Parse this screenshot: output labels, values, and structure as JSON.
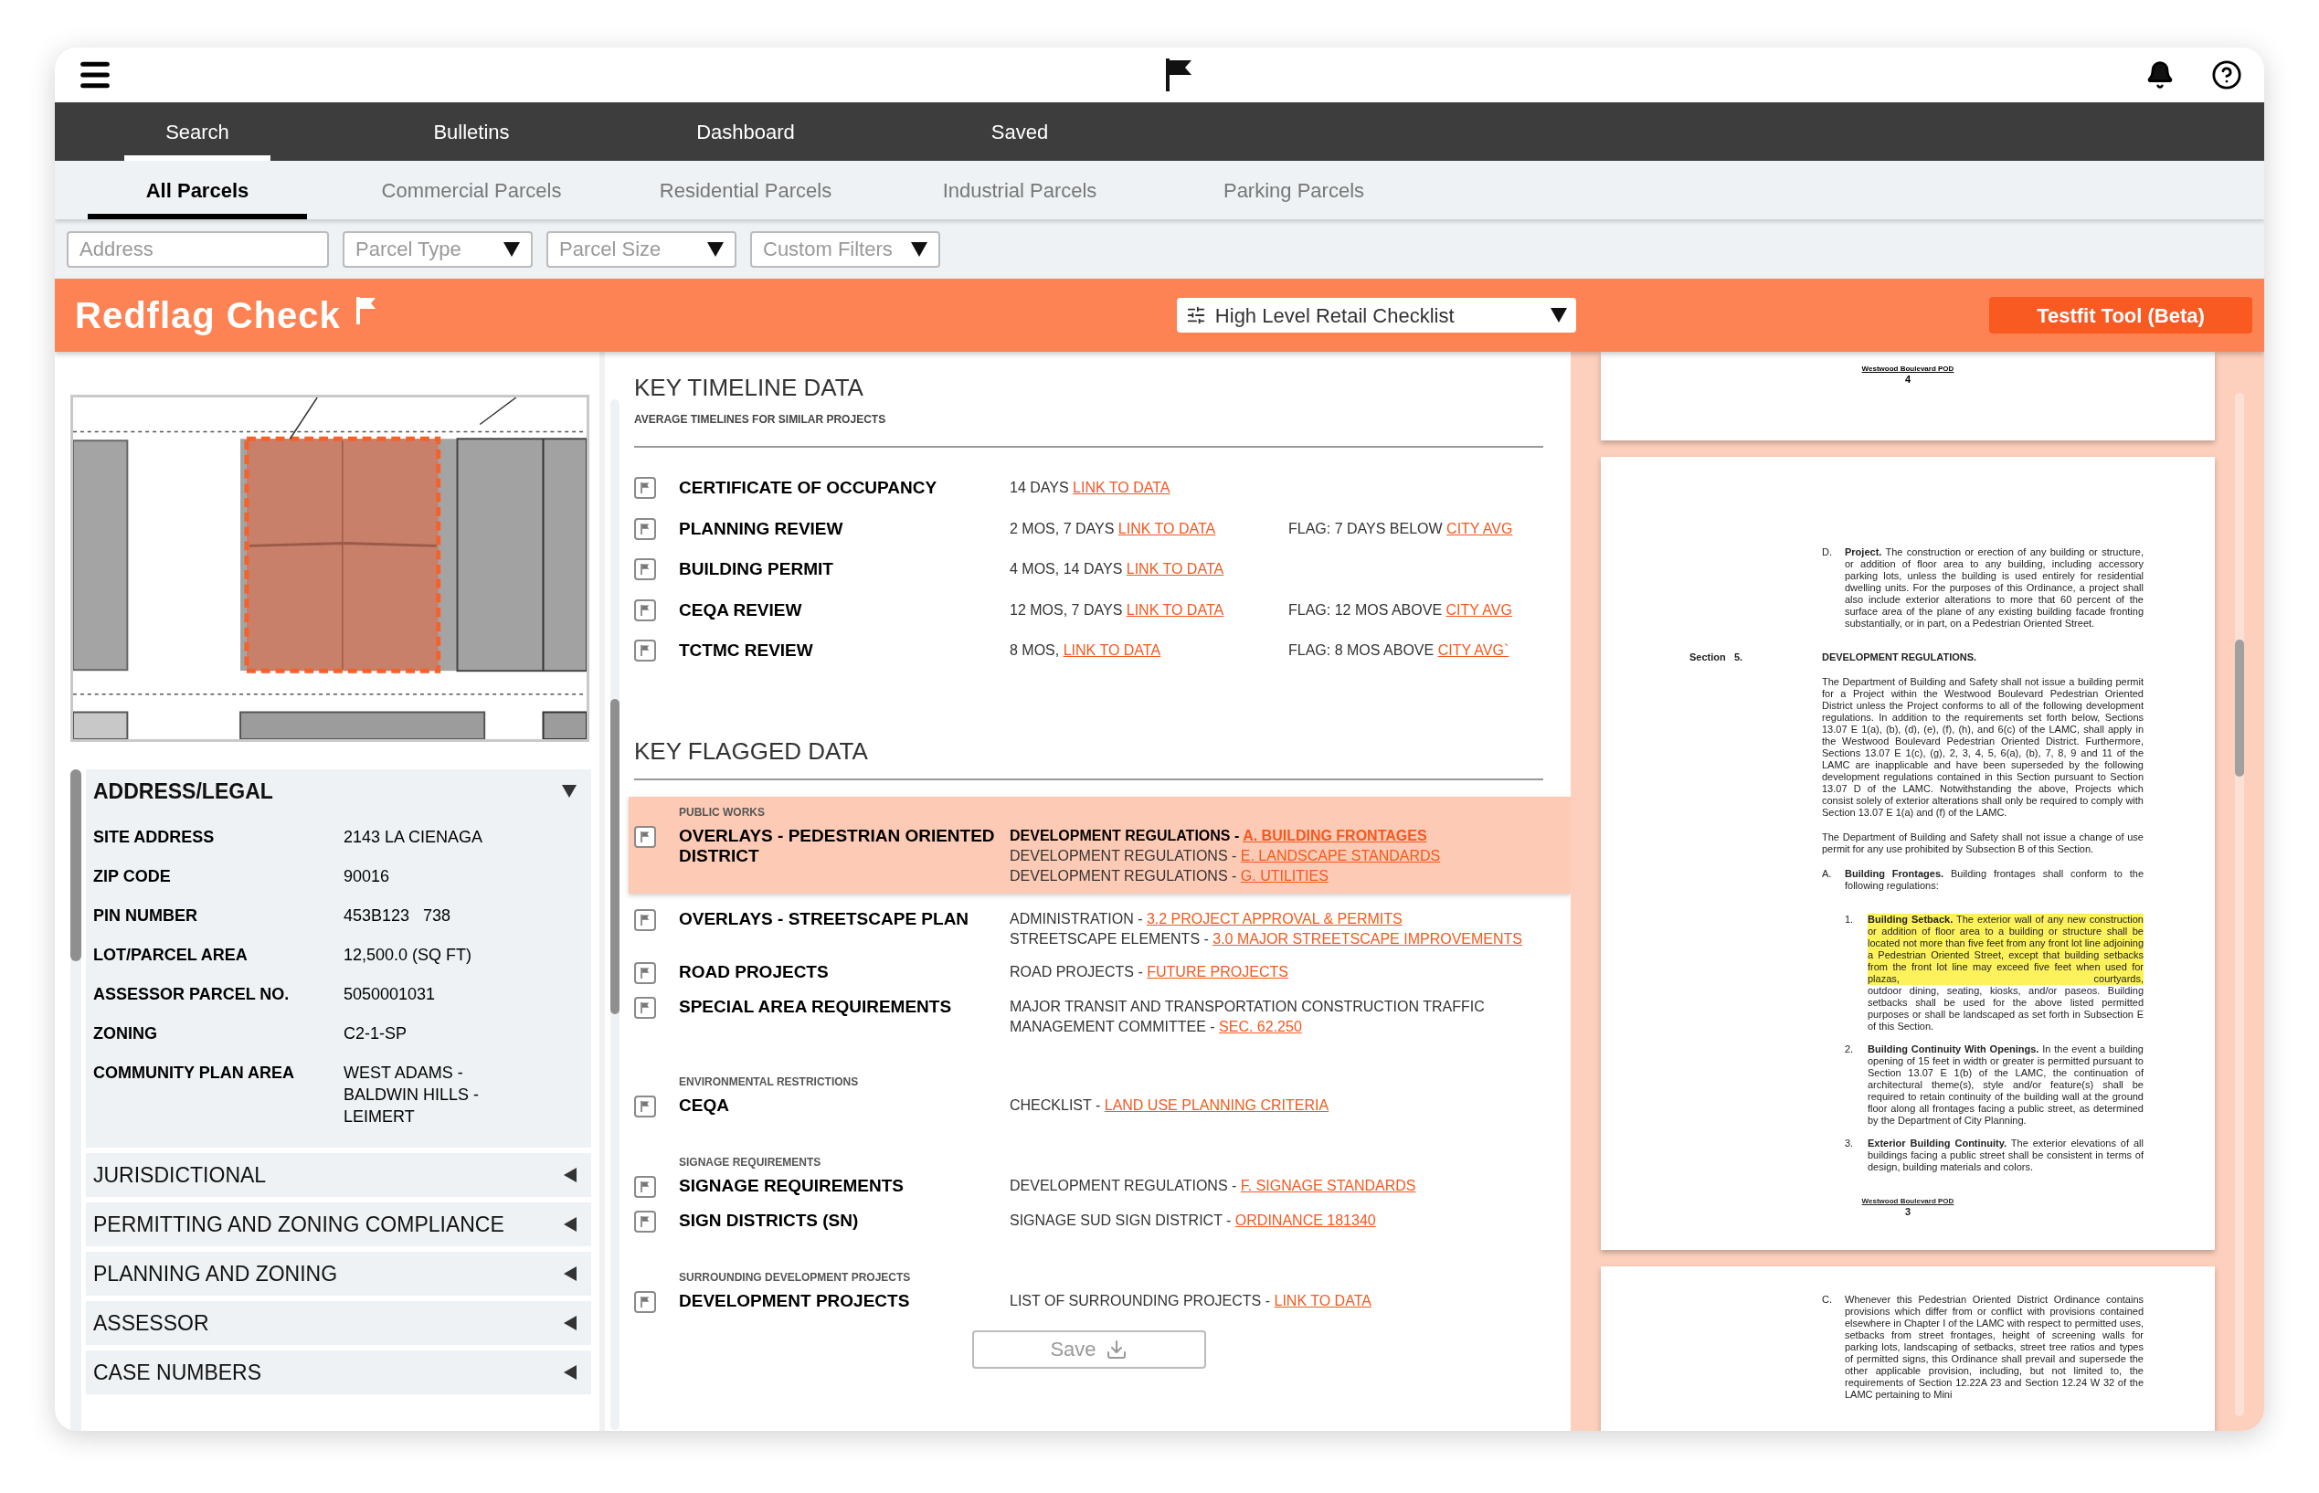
{
  "nav_tabs": [
    {
      "label": "Search",
      "selected": true
    },
    {
      "label": "Bulletins",
      "selected": false
    },
    {
      "label": "Dashboard",
      "selected": false
    },
    {
      "label": "Saved",
      "selected": false
    }
  ],
  "sub_tabs": [
    {
      "label": "All Parcels",
      "selected": true
    },
    {
      "label": "Commercial Parcels",
      "selected": false
    },
    {
      "label": "Residential Parcels",
      "selected": false
    },
    {
      "label": "Industrial Parcels",
      "selected": false
    },
    {
      "label": "Parking Parcels",
      "selected": false
    }
  ],
  "filters": [
    {
      "kind": "text",
      "placeholder": "Address"
    },
    {
      "kind": "select",
      "label": "Parcel Type"
    },
    {
      "kind": "select",
      "label": "Parcel Size"
    },
    {
      "kind": "select",
      "label": "Custom Filters"
    }
  ],
  "banner": {
    "title": "Redflag Check",
    "checklist": "High Level Retail Checklist",
    "button": "Testfit Tool (Beta)"
  },
  "accordion": [
    {
      "title": "ADDRESS/LEGAL",
      "expanded": true,
      "fields": [
        {
          "label": "SITE ADDRESS",
          "value": "2143 LA CIENAGA"
        },
        {
          "label": "ZIP CODE",
          "value": "90016"
        },
        {
          "label": "PIN NUMBER",
          "value": "453B123   738"
        },
        {
          "label": "LOT/PARCEL AREA",
          "value": "12,500.0 (SQ FT)"
        },
        {
          "label": "ASSESSOR PARCEL NO.",
          "value": "5050001031"
        },
        {
          "label": "ZONING",
          "value": "C2-1-SP"
        },
        {
          "label": "COMMUNITY PLAN AREA",
          "value": "WEST ADAMS - BALDWIN HILLS - LEIMERT"
        }
      ]
    },
    {
      "title": "JURISDICTIONAL",
      "expanded": false
    },
    {
      "title": "PERMITTING AND ZONING COMPLIANCE",
      "expanded": false
    },
    {
      "title": "PLANNING AND ZONING",
      "expanded": false
    },
    {
      "title": "ASSESSOR",
      "expanded": false
    },
    {
      "title": "CASE NUMBERS",
      "expanded": false
    }
  ],
  "timeline": {
    "title": "KEY TIMELINE DATA",
    "subtitle": "AVERAGE TIMELINES FOR SIMILAR PROJECTS",
    "rows": [
      {
        "label": "CERTIFICATE OF OCCUPANCY",
        "value": "14 DAYS",
        "link": "LINK TO DATA"
      },
      {
        "label": "PLANNING REVIEW",
        "value": "2 MOS, 7 DAYS",
        "link": "LINK TO DATA",
        "flag": "FLAG: 7 DAYS BELOW",
        "flag_link": "CITY AVG"
      },
      {
        "label": "BUILDING PERMIT",
        "value": "4 MOS, 14 DAYS",
        "link": "LINK TO DATA"
      },
      {
        "label": "CEQA REVIEW",
        "value": "12 MOS, 7 DAYS",
        "link": "LINK TO DATA",
        "flag": "FLAG: 12 MOS ABOVE",
        "flag_link": "CITY AVG"
      },
      {
        "label": "TCTMC REVIEW",
        "value": "8 MOS,",
        "link": "LINK TO DATA",
        "flag": "FLAG: 8 MOS ABOVE",
        "flag_link": "CITY AVG`"
      }
    ]
  },
  "flagged": {
    "title": "KEY FLAGGED DATA",
    "save": "Save",
    "rows": [
      {
        "category": "PUBLIC WORKS",
        "label": "OVERLAYS - PEDESTRIAN ORIENTED DISTRICT",
        "selected": true,
        "details": [
          {
            "text": "DEVELOPMENT REGULATIONS - ",
            "link": "A. BUILDING FRONTAGES",
            "bold": true
          },
          {
            "text": "DEVELOPMENT REGULATIONS - ",
            "link": "E. LANDSCAPE STANDARDS",
            "bold": false
          },
          {
            "text": "DEVELOPMENT REGULATIONS - ",
            "link": "G. UTILITIES",
            "bold": false
          }
        ]
      },
      {
        "label": "OVERLAYS - STREETSCAPE PLAN",
        "selected": false,
        "details": [
          {
            "text": "ADMINISTRATION - ",
            "link": "3.2 PROJECT APPROVAL & PERMITS",
            "bold": false
          },
          {
            "text": "STREETSCAPE ELEMENTS - ",
            "link": "3.0 MAJOR STREETSCAPE IMPROVEMENTS",
            "bold": false
          }
        ]
      },
      {
        "label": "ROAD PROJECTS",
        "selected": false,
        "details": [
          {
            "text": "ROAD PROJECTS - ",
            "link": "FUTURE PROJECTS",
            "bold": false
          }
        ]
      },
      {
        "label": "SPECIAL AREA REQUIREMENTS",
        "selected": false,
        "details": [
          {
            "text": "MAJOR TRANSIT AND TRANSPORTATION CONSTRUCTION TRAFFIC MANAGEMENT COMMITTEE - ",
            "link": "SEC. 62.250",
            "bold": false
          }
        ]
      },
      {
        "category": "ENVIRONMENTAL RESTRICTIONS",
        "label": "CEQA",
        "selected": false,
        "details": [
          {
            "text": "CHECKLIST - ",
            "link": "LAND USE PLANNING CRITERIA",
            "bold": false
          }
        ]
      },
      {
        "category": "SIGNAGE REQUIREMENTS",
        "label": "SIGNAGE REQUIREMENTS",
        "selected": false,
        "details": [
          {
            "text": "DEVELOPMENT REGULATIONS - ",
            "link": "F. SIGNAGE STANDARDS",
            "bold": false
          }
        ]
      },
      {
        "label": "SIGN DISTRICTS (SN)",
        "selected": false,
        "details": [
          {
            "text": "SIGNAGE SUD SIGN DISTRICT - ",
            "link": "ORDINANCE 181340",
            "bold": false
          }
        ]
      },
      {
        "category": "SURROUNDING DEVELOPMENT PROJECTS",
        "label": "DEVELOPMENT PROJECTS",
        "selected": false,
        "details": [
          {
            "text": "LIST OF SURROUNDING PROJECTS - ",
            "link": "LINK TO DATA",
            "bold": false
          }
        ]
      }
    ]
  },
  "document": {
    "pages": [
      {
        "kind": "tail",
        "footer_title": "Westwood Boulevard POD",
        "page_number": "4"
      },
      {
        "kind": "full",
        "footer_title": "Westwood Boulevard POD",
        "page_number": "3",
        "blocks": [
          {
            "kind": "item",
            "marker": "D.",
            "text": "**Project.**  The construction or erection of any building or structure, or addition of floor area to any building, including accessory parking lots, unless the building is used entirely for residential dwelling units.  For the purposes of this Ordinance, a project shall also include exterior alterations to more that 60 percent of the surface area of the plane of any existing building facade fronting substantially, or in part, on a Pedestrian Oriented Street."
          },
          {
            "kind": "section",
            "marker": "Section   5.",
            "text": "DEVELOPMENT REGULATIONS."
          },
          {
            "kind": "para",
            "text": "The Department of Building and Safety shall not issue a building permit for a Project within the Westwood Boulevard Pedestrian Oriented District unless the Project conforms to all of the following development regulations. In addition to the requirements set forth below, Sections 13.07 E 1(a), (b), (d), (e), (f), (h), and 6(c) of the LAMC, shall apply in the Westwood Boulevard Pedestrian Oriented District. Furthermore, Sections 13.07 E 1(c), (g), 2, 3, 4, 5, 6(a), (b), 7, 8, 9 and 11 of the LAMC are inapplicable and have been superseded by the following development regulations contained in this Section pursuant to Section 13.07 D of the LAMC.  Notwithstanding the above, Projects which consist solely of exterior alterations shall only be required to comply with Section 13.07 E 1(a) and (f) of the LAMC."
          },
          {
            "kind": "para",
            "text": "The Department of Building and Safety shall not issue a change of use permit for any use prohibited by Subsection B of this Section."
          },
          {
            "kind": "item",
            "marker": "A.",
            "text": "**Building Frontages.**  Building frontages shall conform to the following regulations:"
          },
          {
            "kind": "subitem",
            "marker": "1.",
            "highlight": "**Building Setback.**  The exterior wall of any new construction or addition of floor area to a building or structure shall be located not more than five feet from any front lot line adjoining a Pedestrian Oriented Street, except that building setbacks from the front lot line may exceed five feet when used for plazas, courtyards,",
            "text": "outdoor dining, seating, kiosks, and/or paseos.  Building setbacks shall be used for the above listed permitted purposes or shall be landscaped as set forth in Subsection E of this Section."
          },
          {
            "kind": "subitem",
            "marker": "2.",
            "text": "**Building Continuity With Openings.**  In the event a building opening of 15 feet in width or greater is permitted pursuant to Section 13.07 E 1(b) of the LAMC, the continuation of architectural theme(s), style and/or feature(s) shall be required to retain continuity of the building wall at the ground floor along all frontages facing a public street, as determined by the Department of City Planning."
          },
          {
            "kind": "subitem",
            "marker": "3.",
            "text": "**Exterior Building Continuity.**  The exterior elevations of all buildings facing a public street shall be consistent in terms of design, building materials and colors."
          }
        ]
      },
      {
        "kind": "head",
        "blocks": [
          {
            "kind": "item",
            "marker": "C.",
            "text": "Whenever this Pedestrian Oriented District Ordinance contains provisions which differ from or conflict with provisions contained elsewhere in Chapter I of the LAMC with respect to permitted uses, setbacks from street frontages, height of screening walls for parking lots, landscaping of setbacks, street tree ratios and types of permitted signs, this Ordinance shall prevail and supersede the other applicable provision, including, but not limited to, the requirements of Section 12.22A 23 and Section 12.24 W 32 of the LAMC pertaining to Mini"
          }
        ]
      }
    ]
  }
}
